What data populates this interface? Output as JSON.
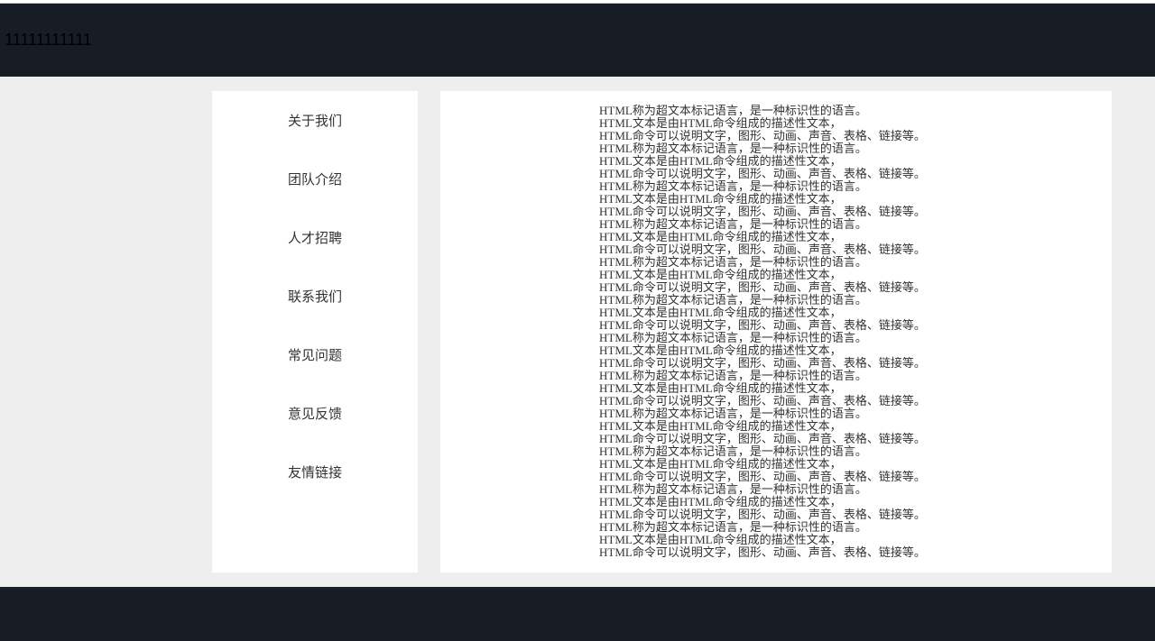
{
  "header": {
    "text": "11111111111"
  },
  "sidebar": {
    "items": [
      {
        "label": "关于我们"
      },
      {
        "label": "团队介绍"
      },
      {
        "label": "人才招聘"
      },
      {
        "label": "联系我们"
      },
      {
        "label": "常见问题"
      },
      {
        "label": "意见反馈"
      },
      {
        "label": "友情链接"
      }
    ]
  },
  "content": {
    "block": {
      "line1": "HTML称为超文本标记语言，是一种标识性的语言。",
      "line2": "HTML文本是由HTML命令组成的描述性文本，",
      "line3": "HTML命令可以说明文字，图形、动画、声音、表格、链接等。"
    },
    "repeatCount": 12
  }
}
